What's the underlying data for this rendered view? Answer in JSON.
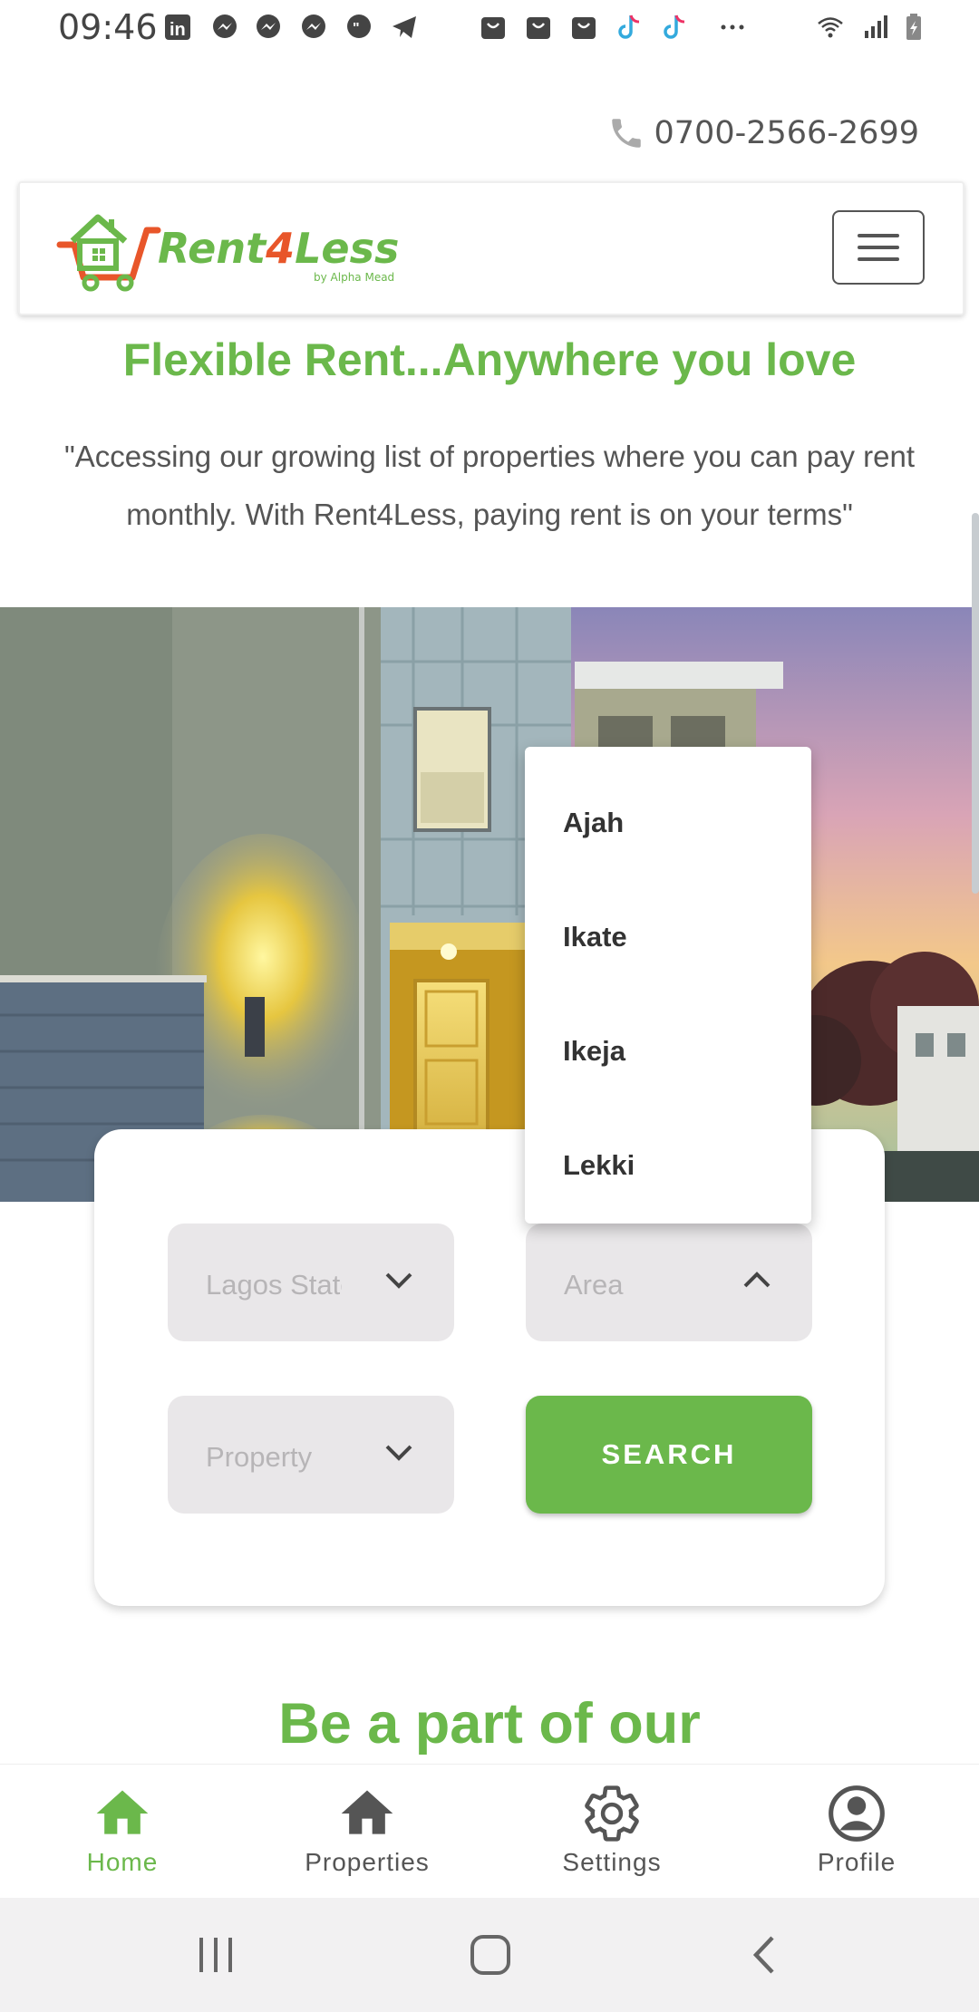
{
  "status_bar": {
    "time": "09:46",
    "icons": [
      "linkedin-icon",
      "messenger-icon",
      "messenger-icon",
      "messenger-icon",
      "chat-icon",
      "telegram-icon",
      "shop-icon",
      "shop-icon",
      "shop-icon",
      "tiktok-icon",
      "tiktok-icon",
      "more-icon",
      "wifi-icon",
      "signal-icon",
      "battery-icon"
    ]
  },
  "header": {
    "phone": "0700-2566-2699",
    "logo_text": "Rent4Less",
    "logo_sub": "by Alpha Mead"
  },
  "hero": {
    "tagline": "Flexible Rent...Anywhere you love",
    "intro": "\"Accessing our growing list of properties where you can pay rent monthly. With Rent4Less, paying rent is on your terms\""
  },
  "search": {
    "state_placeholder": "Lagos State",
    "area_placeholder": "Area",
    "property_placeholder": "Property",
    "button_label": "SEARCH"
  },
  "area_dropdown": {
    "options": [
      "Ajah",
      "Ikate",
      "Ikeja",
      "Lekki"
    ]
  },
  "section": {
    "heading": "Be a part of our"
  },
  "bottom_nav": {
    "items": [
      {
        "label": "Home",
        "icon": "home-icon",
        "active": true
      },
      {
        "label": "Properties",
        "icon": "home-icon",
        "active": false
      },
      {
        "label": "Settings",
        "icon": "gear-icon",
        "active": false
      },
      {
        "label": "Profile",
        "icon": "account-circle-icon",
        "active": false
      }
    ]
  },
  "colors": {
    "brand_green": "#6bb84b",
    "brand_orange": "#e8562a",
    "select_bg": "#e9e7e9"
  }
}
